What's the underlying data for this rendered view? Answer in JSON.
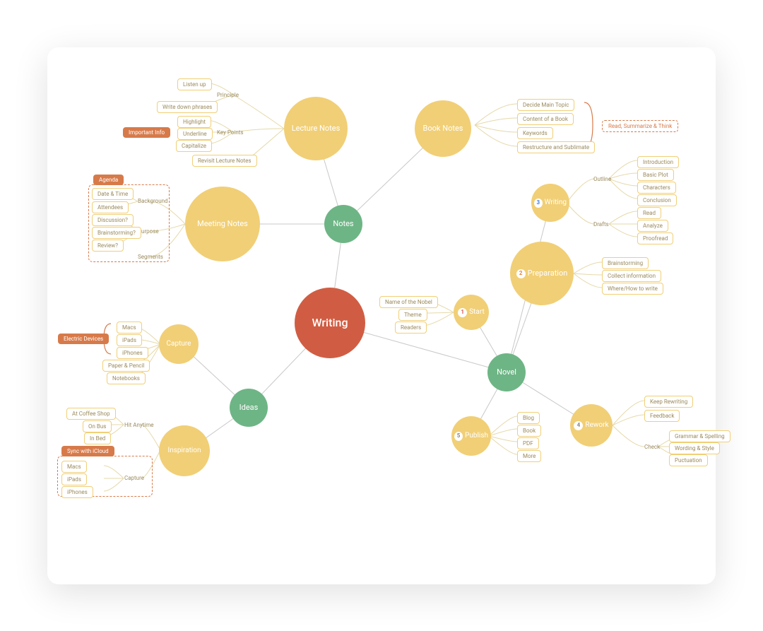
{
  "root": "Writing",
  "branches": {
    "notes": {
      "label": "Notes",
      "children": {
        "lecture": {
          "label": "Lecture Notes",
          "subs": {
            "principle": {
              "label": "Principle",
              "leaves": [
                "Listen up",
                "Write down phrases"
              ]
            },
            "keypoints": {
              "label": "Key Points",
              "leaves": [
                "Highlight",
                "Underline",
                "Capitalize"
              ],
              "tag": "Important Info"
            },
            "revisit": "Revisit Lecture Notes"
          }
        },
        "book": {
          "label": "Book Notes",
          "leaves": [
            "Decide Main Topic",
            "Content of a Book",
            "Keywords",
            "Restructure and Sublimate"
          ],
          "tag": "Read, Summarize & Think"
        },
        "meeting": {
          "label": "Meeting Notes",
          "tag": "Agenda",
          "subs": {
            "background": {
              "label": "Background",
              "leaves": [
                "Date & Time",
                "Attendees"
              ]
            },
            "purpose": {
              "label": "Purpose",
              "leaves": [
                "Discussion?",
                "Brainstorming?",
                "Review?"
              ]
            },
            "segments": "Segments"
          }
        }
      }
    },
    "ideas": {
      "label": "Ideas",
      "children": {
        "capture": {
          "label": "Capture",
          "tag": "Electric Devices",
          "subs": {
            "devices": [
              "Macs",
              "iPads",
              "iPhones"
            ],
            "other": [
              "Paper & Pencil",
              "Notebooks"
            ]
          }
        },
        "inspiration": {
          "label": "Inspiration",
          "subs": {
            "anytime": {
              "label": "Hit Anytime",
              "leaves": [
                "At Coffee Shop",
                "On Bus",
                "In Bed"
              ]
            },
            "icloud": {
              "tag": "Sync with iCloud",
              "label": "Capture",
              "leaves": [
                "Macs",
                "iPads",
                "iPhones"
              ]
            }
          }
        }
      }
    },
    "novel": {
      "label": "Novel",
      "children": {
        "start": {
          "num": "1",
          "label": "Start",
          "leaves": [
            "Name of the Nobel",
            "Theme",
            "Readers"
          ]
        },
        "preparation": {
          "num": "2",
          "label": "Preparation",
          "leaves": [
            "Brainstorming",
            "Collect information",
            "Where/How to write"
          ]
        },
        "writing": {
          "num": "3",
          "label": "Writing",
          "subs": {
            "outline": {
              "label": "Outline",
              "leaves": [
                "Introduction",
                "Basic Plot",
                "Characters",
                "Conclusion"
              ]
            },
            "drafts": {
              "label": "Drafts",
              "leaves": [
                "Read",
                "Analyze",
                "Proofread"
              ]
            }
          }
        },
        "rework": {
          "num": "4",
          "label": "Rework",
          "leaves_top": [
            "Keep Rewriting",
            "Feedback"
          ],
          "check": {
            "label": "Check",
            "leaves": [
              "Grammar & Spelling",
              "Wording & Style",
              "Puctuation"
            ]
          }
        },
        "publish": {
          "num": "5",
          "label": "Publish",
          "leaves": [
            "Blog",
            "Book",
            "PDF",
            "More"
          ]
        }
      }
    }
  }
}
